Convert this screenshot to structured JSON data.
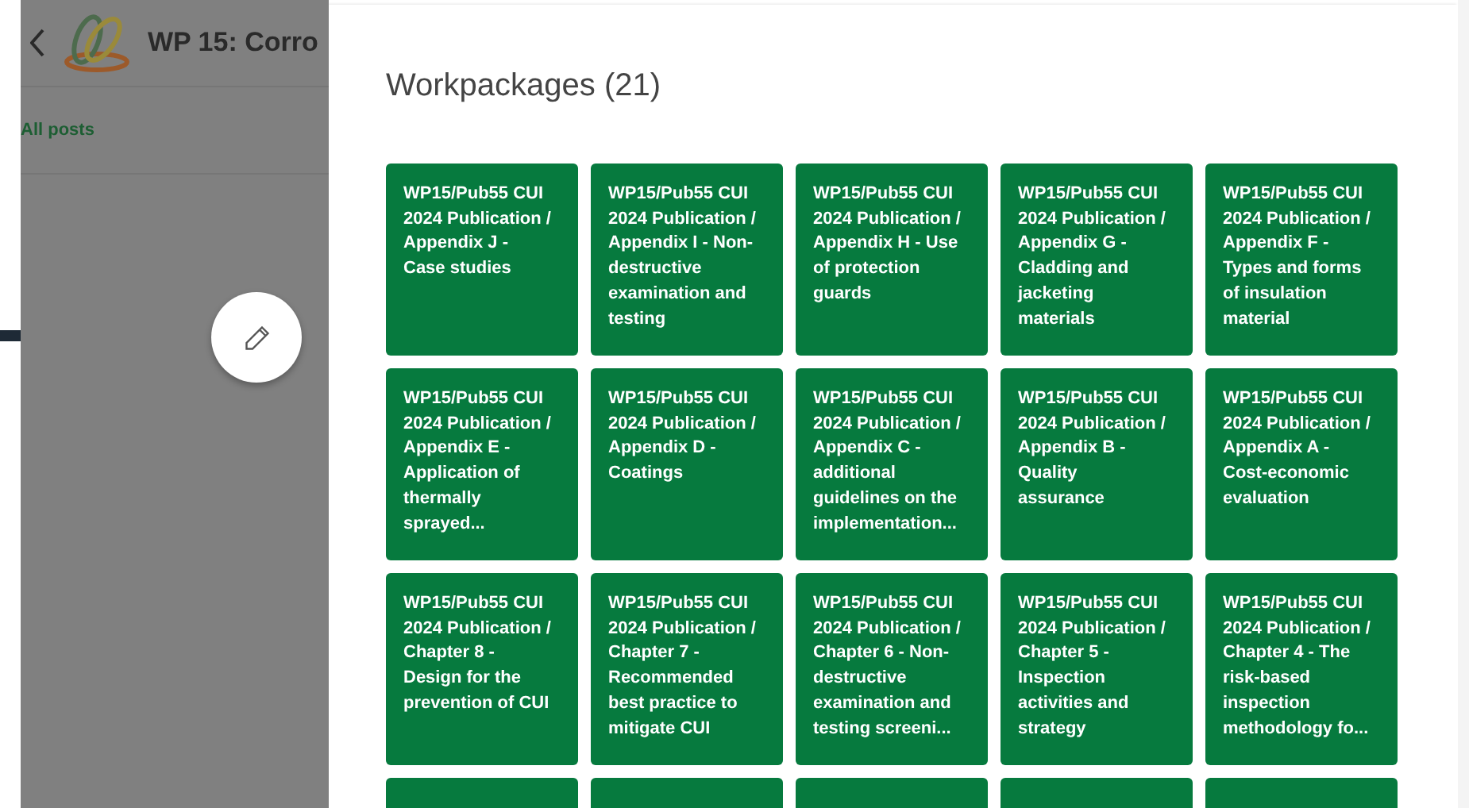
{
  "background_page": {
    "title": "WP 15: Corro",
    "tab": "All posts"
  },
  "modal": {
    "title": "Workpackages (21)",
    "cards": [
      {
        "text": "WP15/Pub55 CUI 2024 Publication / Appendix J - Case studies"
      },
      {
        "text": "WP15/Pub55 CUI 2024 Publication / Appendix I - Non-destructive examination and testing"
      },
      {
        "text": "WP15/Pub55 CUI 2024 Publication / Appendix H - Use of protection guards"
      },
      {
        "text": "WP15/Pub55 CUI 2024 Publication / Appendix G - Cladding and jacketing materials"
      },
      {
        "text": "WP15/Pub55 CUI 2024 Publication / Appendix F - Types and forms of insulation material"
      },
      {
        "text": "WP15/Pub55 CUI 2024 Publication / Appendix E - Application of thermally sprayed..."
      },
      {
        "text": "WP15/Pub55 CUI 2024 Publication / Appendix D - Coatings"
      },
      {
        "text": "WP15/Pub55 CUI 2024 Publication / Appendix C - additional guidelines on the implementation..."
      },
      {
        "text": "WP15/Pub55 CUI 2024 Publication / Appendix B - Quality assurance"
      },
      {
        "text": "WP15/Pub55 CUI 2024 Publication / Appendix A - Cost-economic evaluation"
      },
      {
        "text": "WP15/Pub55 CUI 2024 Publication / Chapter 8 - Design for the prevention of CUI"
      },
      {
        "text": "WP15/Pub55 CUI 2024 Publication / Chapter 7 - Recommended best practice to mitigate CUI"
      },
      {
        "text": "WP15/Pub55 CUI 2024 Publication / Chapter 6 - Non-destructive examination and testing screeni..."
      },
      {
        "text": "WP15/Pub55 CUI 2024 Publication / Chapter 5 - Inspection activities and strategy"
      },
      {
        "text": "WP15/Pub55 CUI 2024 Publication / Chapter 4 - The risk-based inspection methodology fo..."
      },
      {
        "kind": "cut"
      },
      {
        "kind": "cut"
      },
      {
        "kind": "cut"
      },
      {
        "kind": "cut"
      },
      {
        "kind": "cut"
      }
    ]
  }
}
